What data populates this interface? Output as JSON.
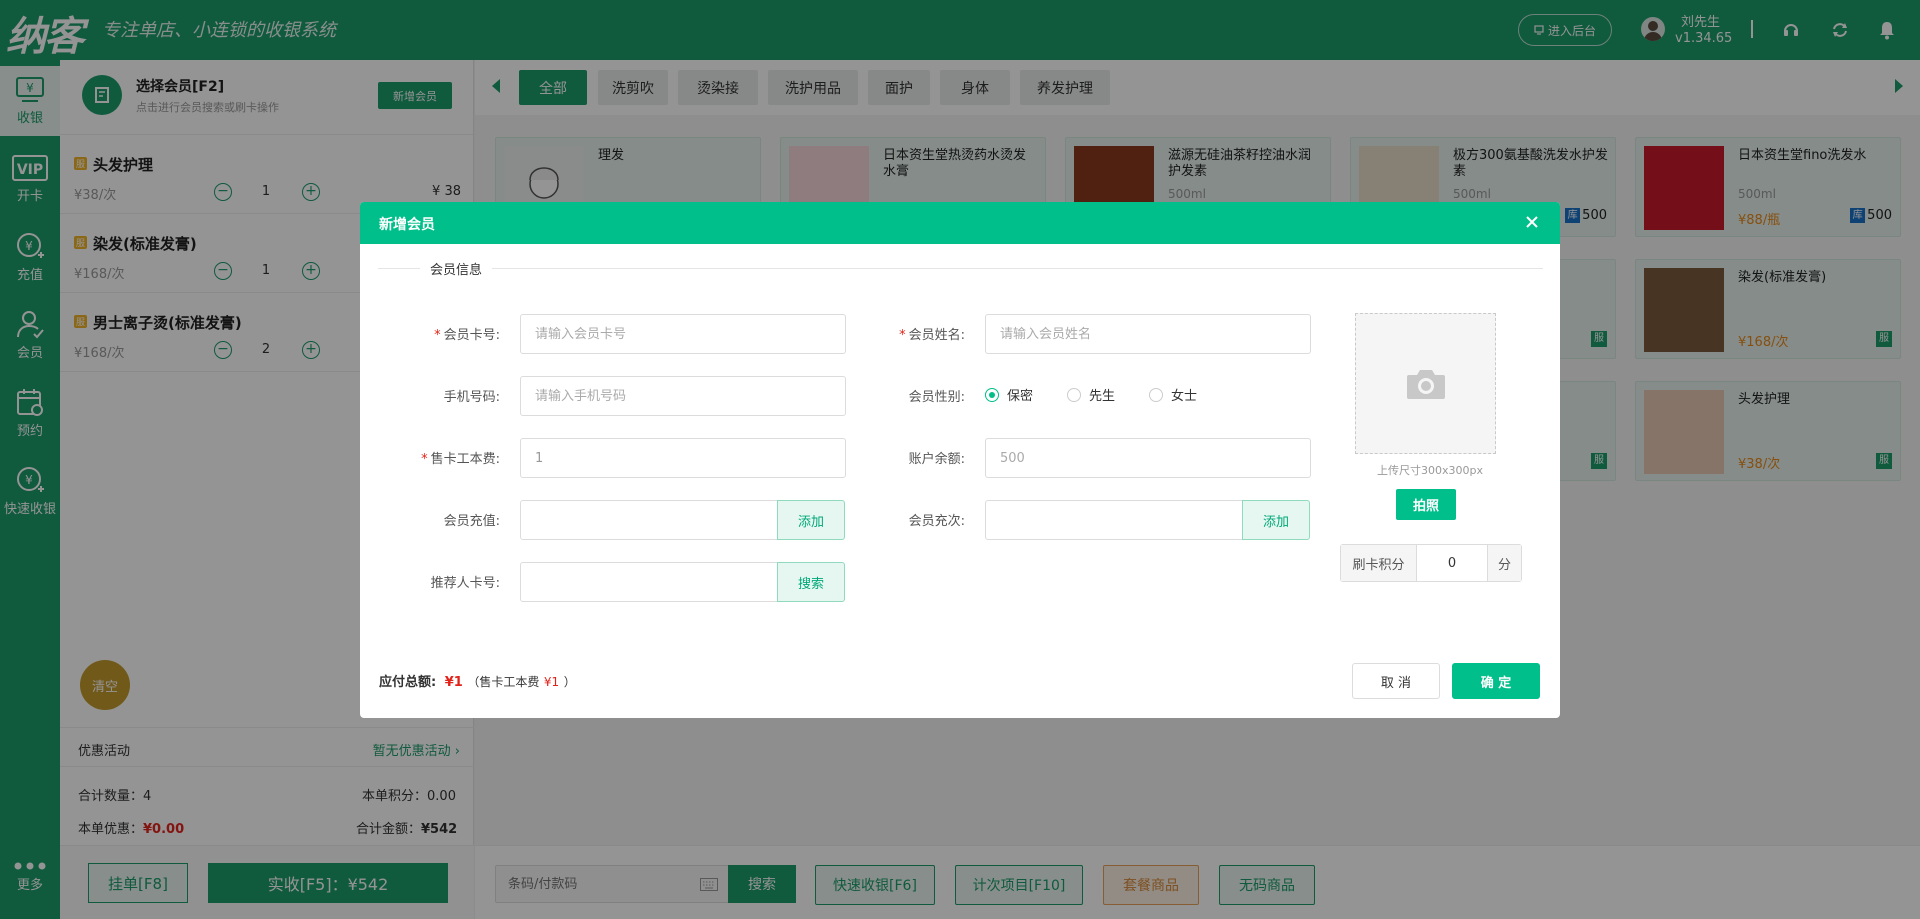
{
  "app": {
    "logo": "纳客",
    "slogan": "专注单店、小连锁的收银系统"
  },
  "header": {
    "admin_label": "进入后台",
    "user_name": "刘先生",
    "version": "v1.34.65"
  },
  "sidebar": {
    "items": [
      {
        "label": "收银"
      },
      {
        "label": "开卡"
      },
      {
        "label": "充值"
      },
      {
        "label": "会员"
      },
      {
        "label": "预约"
      },
      {
        "label": "快速收银"
      }
    ],
    "more_label": "更多"
  },
  "member": {
    "title": "选择会员[F2]",
    "subtitle": "点击进行会员搜索或刷卡操作",
    "new_button": "新增会员"
  },
  "cart": {
    "items": [
      {
        "tag": "服",
        "name": "头发护理",
        "price": "¥38/次",
        "qty": "1",
        "subtotal": "¥ 38"
      },
      {
        "tag": "服",
        "name": "染发(标准发膏)",
        "price": "¥168/次",
        "qty": "1",
        "subtotal": ""
      },
      {
        "tag": "服",
        "name": "男士离子烫(标准发膏)",
        "price": "¥168/次",
        "qty": "2",
        "subtotal": ""
      }
    ],
    "clear_label": "清空",
    "promo_label": "优惠活动",
    "promo_value": "暂无优惠活动 ›",
    "total_qty_label": "合计数量：",
    "total_qty": "4",
    "points_label": "本单积分：",
    "points": "0.00",
    "discount_label": "本单优惠：",
    "discount": "¥0.00",
    "total_label": "合计金额：",
    "total": "¥542",
    "hang_label": "挂单[F8]",
    "pay_label": "实收[F5]：¥542"
  },
  "categories": [
    "全部",
    "洗剪吹",
    "烫染接",
    "洗护用品",
    "面护",
    "身体",
    "养发护理"
  ],
  "products": [
    {
      "name": "理发",
      "spec": "",
      "price": "",
      "stock": ""
    },
    {
      "name": "日本资生堂热烫药水烫发水膏",
      "spec": "",
      "price": "",
      "stock": ""
    },
    {
      "name": "滋源无硅油茶籽控油水润护发素",
      "spec": "500ml",
      "price": "",
      "stock": ""
    },
    {
      "name": "极方300氨基酸洗发水护发素",
      "spec": "500ml",
      "price": "",
      "stock": "500"
    },
    {
      "name": "日本资生堂fino洗发水",
      "spec": "500ml",
      "price": "¥88/瓶",
      "stock": "500"
    },
    {
      "name": "染发(标准发膏)",
      "spec": "",
      "price": "¥168/次",
      "svc": "服"
    },
    {
      "name": "头发护理",
      "spec": "",
      "price": "¥38/次",
      "svc": "服"
    }
  ],
  "stock_tag": "库",
  "svc_tag": "服",
  "bottom": {
    "barcode_placeholder": "条码/付款码",
    "search": "搜索",
    "quick": "快速收银[F6]",
    "count_item": "计次项目[F10]",
    "package": "套餐商品",
    "nocode": "无码商品"
  },
  "modal": {
    "title": "新增会员",
    "section": "会员信息",
    "card_no_label": "会员卡号:",
    "card_no_placeholder": "请输入会员卡号",
    "name_label": "会员姓名:",
    "name_placeholder": "请输入会员姓名",
    "phone_label": "手机号码:",
    "phone_placeholder": "请输入手机号码",
    "gender_label": "会员性别:",
    "gender_options": [
      "保密",
      "先生",
      "女士"
    ],
    "gender_selected": "保密",
    "fee_label": "售卡工本费:",
    "fee_value": "1",
    "balance_label": "账户余额:",
    "balance_placeholder": "500",
    "recharge_label": "会员充值:",
    "recharge_add": "添加",
    "count_label": "会员充次:",
    "count_add": "添加",
    "referrer_label": "推荐人卡号:",
    "referrer_search": "搜索",
    "upload_hint": "上传尺寸300x300px",
    "photo_button": "拍照",
    "points_label": "刷卡积分",
    "points_value": "0",
    "points_unit": "分",
    "total_label": "应付总额:",
    "total_value": "¥1",
    "total_note_prefix": "（售卡工本费",
    "total_note_value": "¥1",
    "total_note_suffix": "）",
    "cancel": "取 消",
    "ok": "确 定"
  },
  "colors": {
    "brand": "#1c9b6c",
    "modal_accent": "#00bf8a",
    "danger": "#e2231a"
  }
}
